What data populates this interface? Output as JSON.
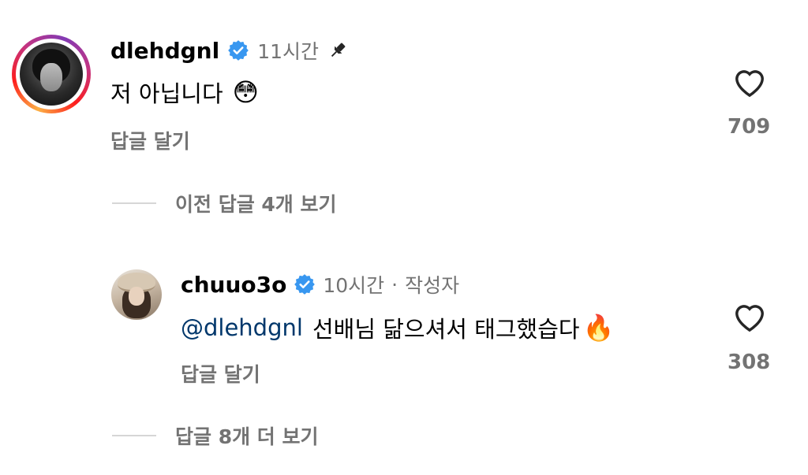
{
  "comments": [
    {
      "username": "dlehdgnl",
      "time": "11시간",
      "text": "저 아닙니다",
      "emoji": "😳",
      "reply_label": "답글 달기",
      "likes": "709"
    }
  ],
  "view_previous": "이전 답글 4개 보기",
  "replies": [
    {
      "username": "chuuo3o",
      "time": "10시간",
      "separator": "·",
      "author_tag": "작성자",
      "mention": "@dlehdgnl",
      "text": "선배님 닮으셔서 태그했습다",
      "emoji": "🔥",
      "reply_label": "답글 달기",
      "likes": "308"
    }
  ],
  "view_more": "답글 8개 더 보기",
  "colors": {
    "verified": "#3897f0",
    "secondary_text": "#737373",
    "mention": "#00376b"
  },
  "icons": [
    "verified-badge-icon",
    "pin-icon",
    "heart-icon"
  ]
}
